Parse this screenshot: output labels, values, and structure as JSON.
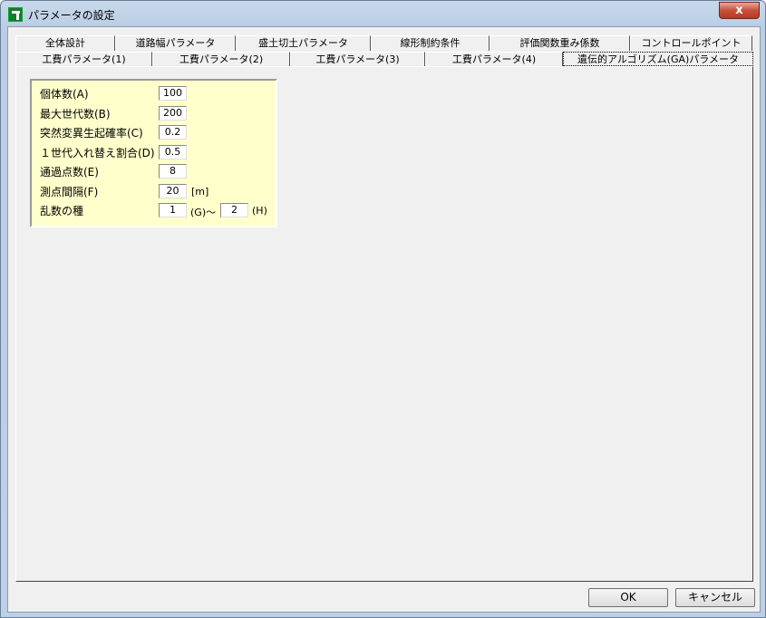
{
  "window": {
    "title": "パラメータの設定",
    "close_label": "x"
  },
  "tabs_row1": [
    "全体設計",
    "道路幅パラメータ",
    "盛土切土パラメータ",
    "線形制約条件",
    "評価関数重み係数",
    "コントロールポイント"
  ],
  "tabs_row2": [
    "工費パラメータ(1)",
    "工費パラメータ(2)",
    "工費パラメータ(3)",
    "工費パラメータ(4)",
    "遺伝的アルゴリズム(GA)パラメータ"
  ],
  "active_tab": "遺伝的アルゴリズム(GA)パラメータ",
  "fields": [
    {
      "label": "個体数(A)",
      "value": "100"
    },
    {
      "label": "最大世代数(B)",
      "value": "200"
    },
    {
      "label": "突然変異生起確率(C)",
      "value": "0.2"
    },
    {
      "label": "１世代入れ替え割合(D)",
      "value": "0.5"
    },
    {
      "label": "通過点数(E)",
      "value": "8"
    },
    {
      "label": "測点間隔(F)",
      "value": "20",
      "unit": "[m]"
    },
    {
      "label": "乱数の種",
      "value": "1",
      "unit": "(G)～",
      "value2": "2",
      "unit2": "(H)"
    }
  ],
  "buttons": {
    "ok": "OK",
    "cancel": "キャンセル"
  }
}
